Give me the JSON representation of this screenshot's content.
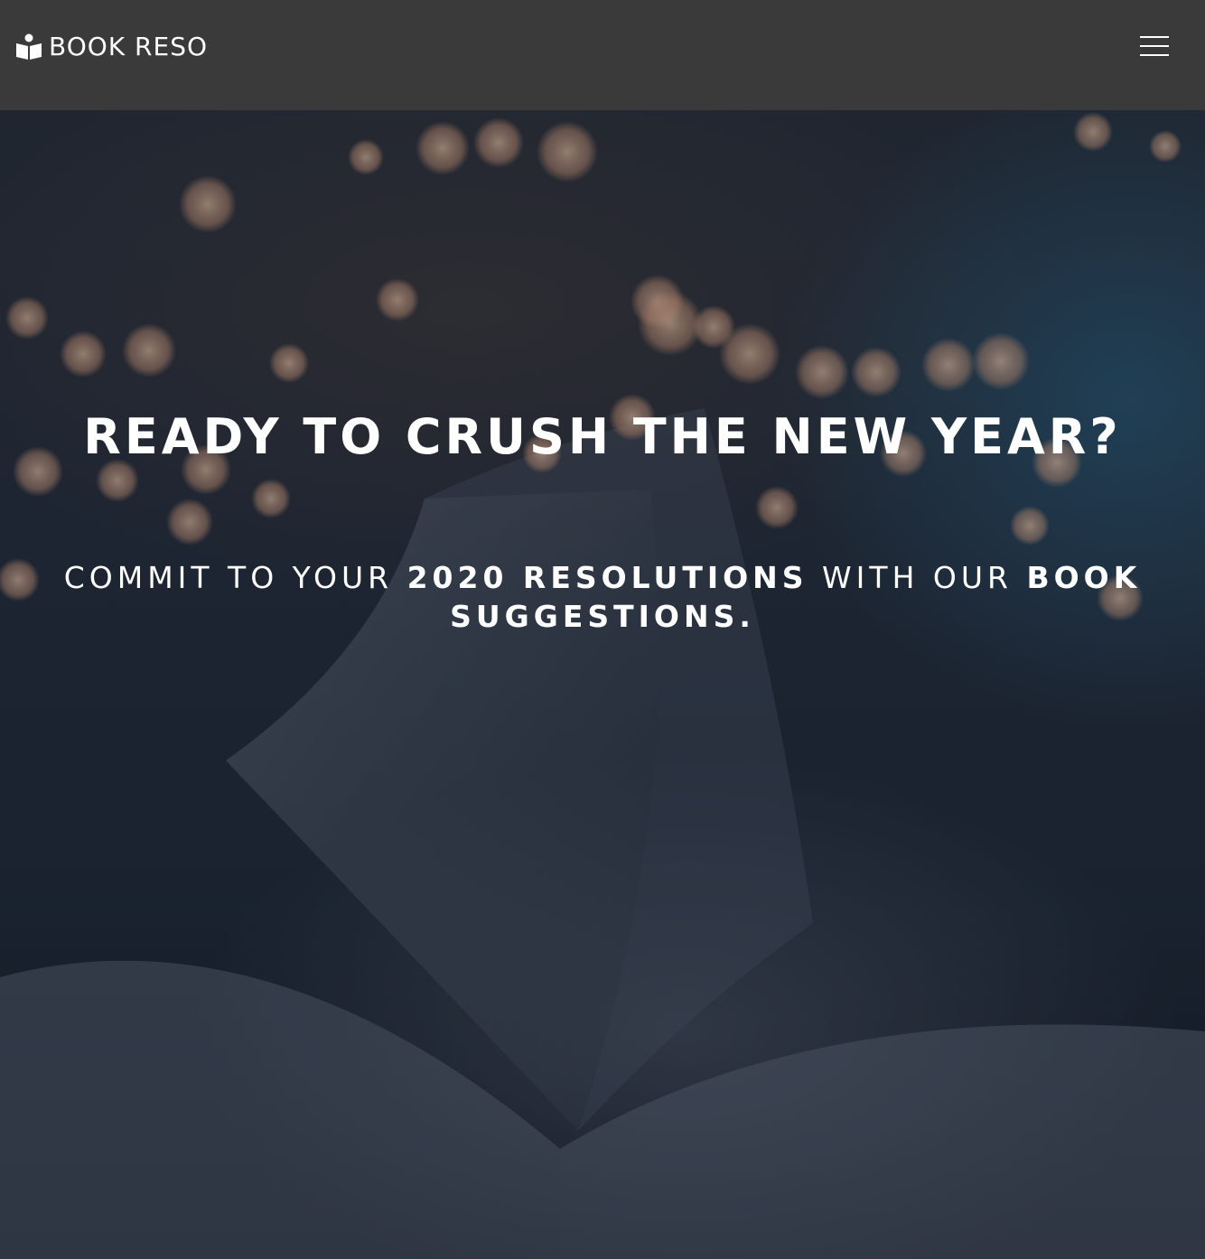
{
  "header": {
    "logo_text": "BOOK RESO",
    "logo_icon": "book-reader-icon",
    "menu_icon": "hamburger-menu-icon"
  },
  "hero": {
    "title": "READY TO CRUSH THE NEW YEAR?",
    "subtitle": {
      "part1": "COMMIT TO YOUR ",
      "part2": "2020 RESOLUTIONS",
      "part3": " WITH OUR ",
      "part4": "BOOK SUGGESTIONS."
    }
  },
  "colors": {
    "header_background": "#3a3a3a",
    "text": "#ffffff",
    "hero_background": "#1b2532"
  }
}
